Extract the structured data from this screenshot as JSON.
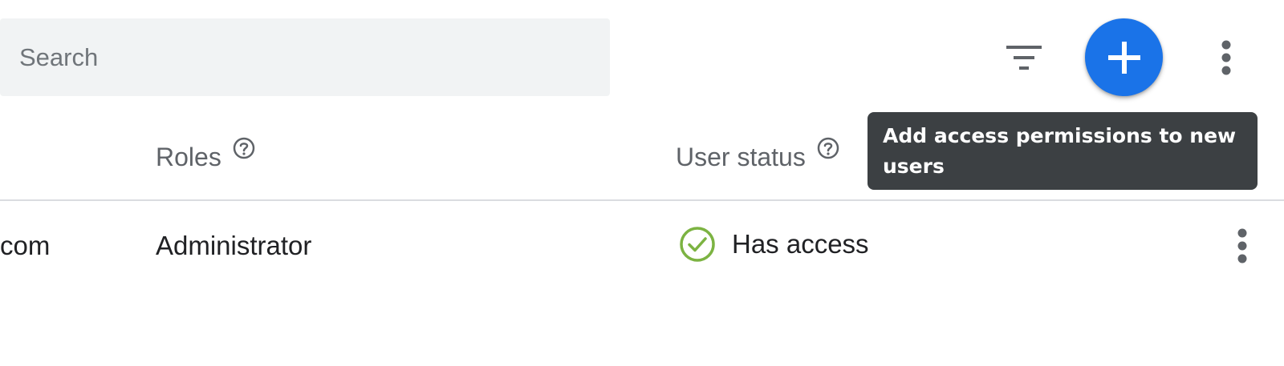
{
  "toolbar": {
    "search_placeholder": "Search",
    "filter_icon": "filter-list-icon",
    "add_icon": "add-icon",
    "more_icon": "more-vert-icon",
    "accent_color": "#1a73e8"
  },
  "tooltip": {
    "text": "Add access permissions to new users"
  },
  "table": {
    "columns": [
      {
        "label": "Roles",
        "help_icon": "help-circle-icon"
      },
      {
        "label": "User status",
        "help_icon": "help-circle-icon"
      }
    ],
    "rows": [
      {
        "email": "com",
        "role": "Administrator",
        "status": "Has access",
        "status_icon": "check-circle-icon",
        "status_color": "#7cb342",
        "more_icon": "more-vert-icon"
      }
    ]
  }
}
